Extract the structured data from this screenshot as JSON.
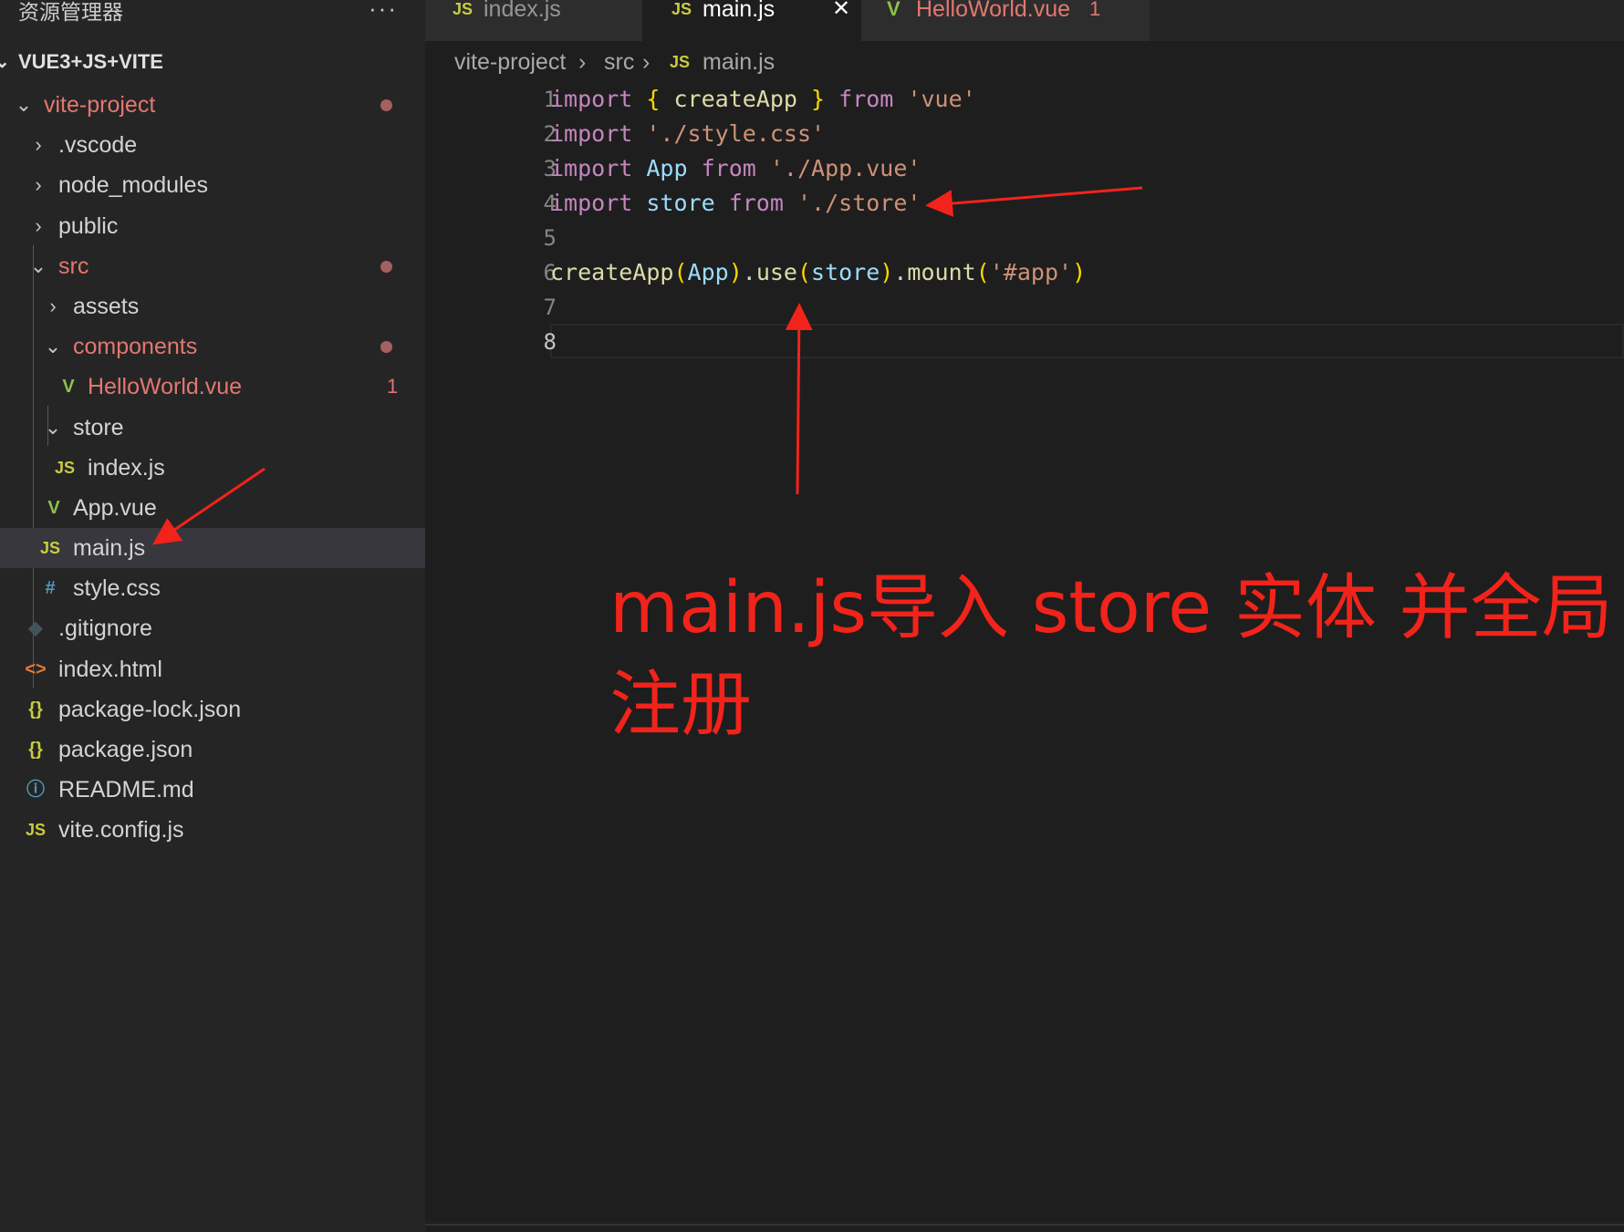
{
  "explorer": {
    "title": "资源管理器",
    "more": "···",
    "root_label": "VUE3+JS+VITE",
    "items": [
      {
        "label": "vite-project",
        "icon": "",
        "status": "dot"
      },
      {
        "label": ".vscode",
        "icon": ""
      },
      {
        "label": "node_modules",
        "icon": ""
      },
      {
        "label": "public",
        "icon": ""
      },
      {
        "label": "src",
        "icon": "",
        "status": "dot"
      },
      {
        "label": "assets",
        "icon": ""
      },
      {
        "label": "components",
        "icon": "",
        "status": "dot"
      },
      {
        "label": "HelloWorld.vue",
        "icon": "V",
        "status": "1"
      },
      {
        "label": "store",
        "icon": ""
      },
      {
        "label": "index.js",
        "icon": "JS"
      },
      {
        "label": "App.vue",
        "icon": "V"
      },
      {
        "label": "main.js",
        "icon": "JS"
      },
      {
        "label": "style.css",
        "icon": "#"
      },
      {
        "label": ".gitignore",
        "icon": "◆"
      },
      {
        "label": "index.html",
        "icon": "<>"
      },
      {
        "label": "package-lock.json",
        "icon": "{}"
      },
      {
        "label": "package.json",
        "icon": "{}"
      },
      {
        "label": "README.md",
        "icon": "ⓘ"
      },
      {
        "label": "vite.config.js",
        "icon": "JS"
      }
    ]
  },
  "tabs": [
    {
      "label": "index.js",
      "icon": "JS"
    },
    {
      "label": "main.js",
      "icon": "JS",
      "close": "✕"
    },
    {
      "label": "HelloWorld.vue",
      "icon": "V",
      "badge": "1"
    }
  ],
  "breadcrumb": {
    "part1": "vite-project",
    "sep": "›",
    "part2": "src",
    "icon": "JS",
    "part3": "main.js"
  },
  "editor": {
    "line_numbers": [
      "1",
      "2",
      "3",
      "4",
      "5",
      "6",
      "7",
      "8"
    ],
    "lines": [
      "import { createApp } from 'vue'",
      "import './style.css'",
      "import App from './App.vue'",
      "import store from './store'",
      "",
      "createApp(App).use(store).mount('#app')",
      "",
      ""
    ]
  },
  "annotation": "main.js导入 store 实体 并全局注册",
  "colors": {
    "annotation": "#f2231a",
    "modified": "#e2786f",
    "keyword": "#c586c0",
    "string": "#ce9178",
    "function": "#dcdcaa",
    "variable": "#9cdcfe"
  }
}
